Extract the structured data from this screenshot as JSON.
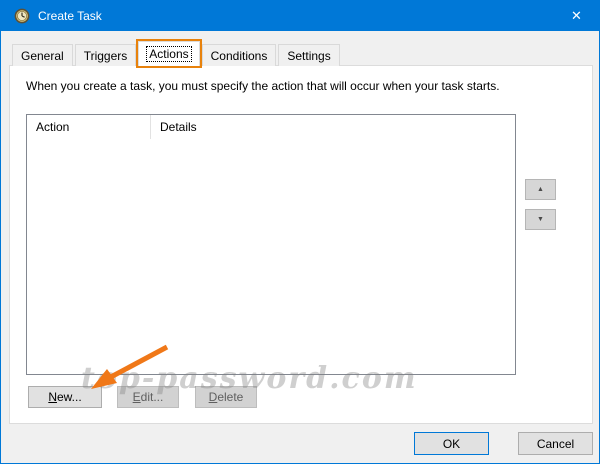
{
  "window": {
    "title": "Create Task",
    "accent_color": "#0078d7",
    "close_glyph": "✕"
  },
  "tabs": {
    "items": [
      {
        "label": "General"
      },
      {
        "label": "Triggers"
      },
      {
        "label": "Actions",
        "selected": true,
        "highlighted": true
      },
      {
        "label": "Conditions"
      },
      {
        "label": "Settings"
      }
    ],
    "highlight_color": "#e8820c"
  },
  "content": {
    "description": "When you create a task, you must specify the action that will occur when your task starts.",
    "list": {
      "columns": [
        "Action",
        "Details"
      ],
      "rows": []
    },
    "reorder": {
      "up_glyph": "▲",
      "down_glyph": "▼"
    },
    "buttons": {
      "new": {
        "u": "N",
        "rest": "ew...",
        "enabled": true
      },
      "edit": {
        "u": "E",
        "rest": "dit...",
        "enabled": false
      },
      "delete": {
        "u": "D",
        "rest": "elete",
        "enabled": false
      }
    }
  },
  "footer": {
    "ok_label": "OK",
    "cancel_label": "Cancel"
  },
  "watermark": {
    "text": "top-password.com"
  },
  "annotation": {
    "arrow_color": "#f07818"
  }
}
